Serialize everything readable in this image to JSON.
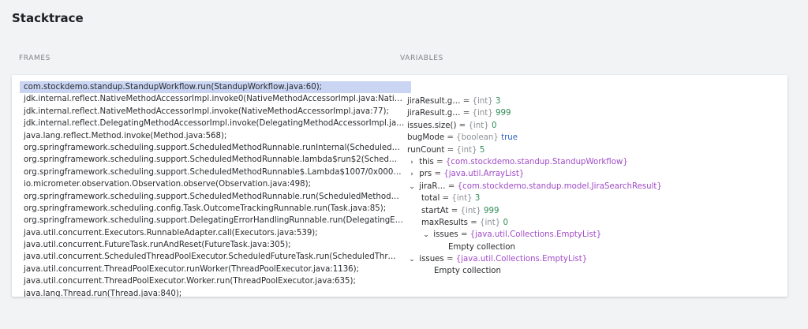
{
  "page": {
    "title": "Stacktrace",
    "frames_label": "FRAMES",
    "variables_label": "VARIABLES"
  },
  "frames": [
    "com.stockdemo.standup.StandupWorkflow.run(StandupWorkflow.java:60);",
    "jdk.internal.reflect.NativeMethodAccessorImpl.invoke0(NativeMethodAccessorImpl.java:Nati…",
    "jdk.internal.reflect.NativeMethodAccessorImpl.invoke(NativeMethodAccessorImpl.java:77);",
    "jdk.internal.reflect.DelegatingMethodAccessorImpl.invoke(DelegatingMethodAccessorImpl.ja…",
    "java.lang.reflect.Method.invoke(Method.java:568);",
    "org.springframework.scheduling.support.ScheduledMethodRunnable.runInternal(Scheduled…",
    "org.springframework.scheduling.support.ScheduledMethodRunnable.lambda$run$2(Sched…",
    "org.springframework.scheduling.support.ScheduledMethodRunnable$.Lambda$1007/0x000…",
    "io.micrometer.observation.Observation.observe(Observation.java:498);",
    "org.springframework.scheduling.support.ScheduledMethodRunnable.run(ScheduledMethod…",
    "org.springframework.scheduling.config.Task.OutcomeTrackingRunnable.run(Task.java:85);",
    "org.springframework.scheduling.support.DelegatingErrorHandlingRunnable.run(DelegatingE…",
    "java.util.concurrent.Executors.RunnableAdapter.call(Executors.java:539);",
    "java.util.concurrent.FutureTask.runAndReset(FutureTask.java:305);",
    "java.util.concurrent.ScheduledThreadPoolExecutor.ScheduledFutureTask.run(ScheduledThr…",
    "java.util.concurrent.ThreadPoolExecutor.runWorker(ThreadPoolExecutor.java:1136);",
    "java.util.concurrent.ThreadPoolExecutor.Worker.run(ThreadPoolExecutor.java:635);",
    "java.lang.Thread.run(Thread.java:840);"
  ],
  "variables": [
    {
      "indent": 0,
      "caret": "",
      "name": "jiraResult.g…",
      "type": "{int}",
      "value": "3",
      "kind": "num"
    },
    {
      "indent": 0,
      "caret": "",
      "name": "jiraResult.g…",
      "type": "{int}",
      "value": "999",
      "kind": "num"
    },
    {
      "indent": 0,
      "caret": "",
      "name": "issues.size()",
      "type": "{int}",
      "value": "0",
      "kind": "num"
    },
    {
      "indent": 0,
      "caret": "",
      "name": "bugMode",
      "type": "{boolean}",
      "value": "true",
      "kind": "bool"
    },
    {
      "indent": 0,
      "caret": "",
      "name": "runCount",
      "type": "{int}",
      "value": "5",
      "kind": "num"
    },
    {
      "indent": 0,
      "caret": "›",
      "name": "this",
      "type": "",
      "value": "{com.stockdemo.standup.StandupWorkflow}",
      "kind": "obj"
    },
    {
      "indent": 0,
      "caret": "›",
      "name": "prs",
      "type": "",
      "value": "{java.util.ArrayList}",
      "kind": "obj"
    },
    {
      "indent": 0,
      "caret": "⌄",
      "name": "jiraR…",
      "type": "",
      "value": "{com.stockdemo.standup.model.JiraSearchResult}",
      "kind": "obj"
    },
    {
      "indent": 1,
      "caret": "",
      "name": "total",
      "type": "{int}",
      "value": "3",
      "kind": "num"
    },
    {
      "indent": 1,
      "caret": "",
      "name": "startAt",
      "type": "{int}",
      "value": "999",
      "kind": "num"
    },
    {
      "indent": 1,
      "caret": "",
      "name": "maxResults",
      "type": "{int}",
      "value": "0",
      "kind": "num"
    },
    {
      "indent": 1,
      "caret": "⌄",
      "name": "issues",
      "type": "",
      "value": "{java.util.Collections.EmptyList}",
      "kind": "obj"
    },
    {
      "indent": 2,
      "caret": "",
      "name": "Empty collection",
      "type": "",
      "value": "",
      "kind": "plain"
    },
    {
      "indent": 0,
      "caret": "⌄",
      "name": "issues",
      "type": "",
      "value": "{java.util.Collections.EmptyList}",
      "kind": "obj"
    },
    {
      "indent": 1,
      "caret": "",
      "name": "Empty collection",
      "type": "",
      "value": "",
      "kind": "plain"
    }
  ],
  "selected_frame_index": 0
}
